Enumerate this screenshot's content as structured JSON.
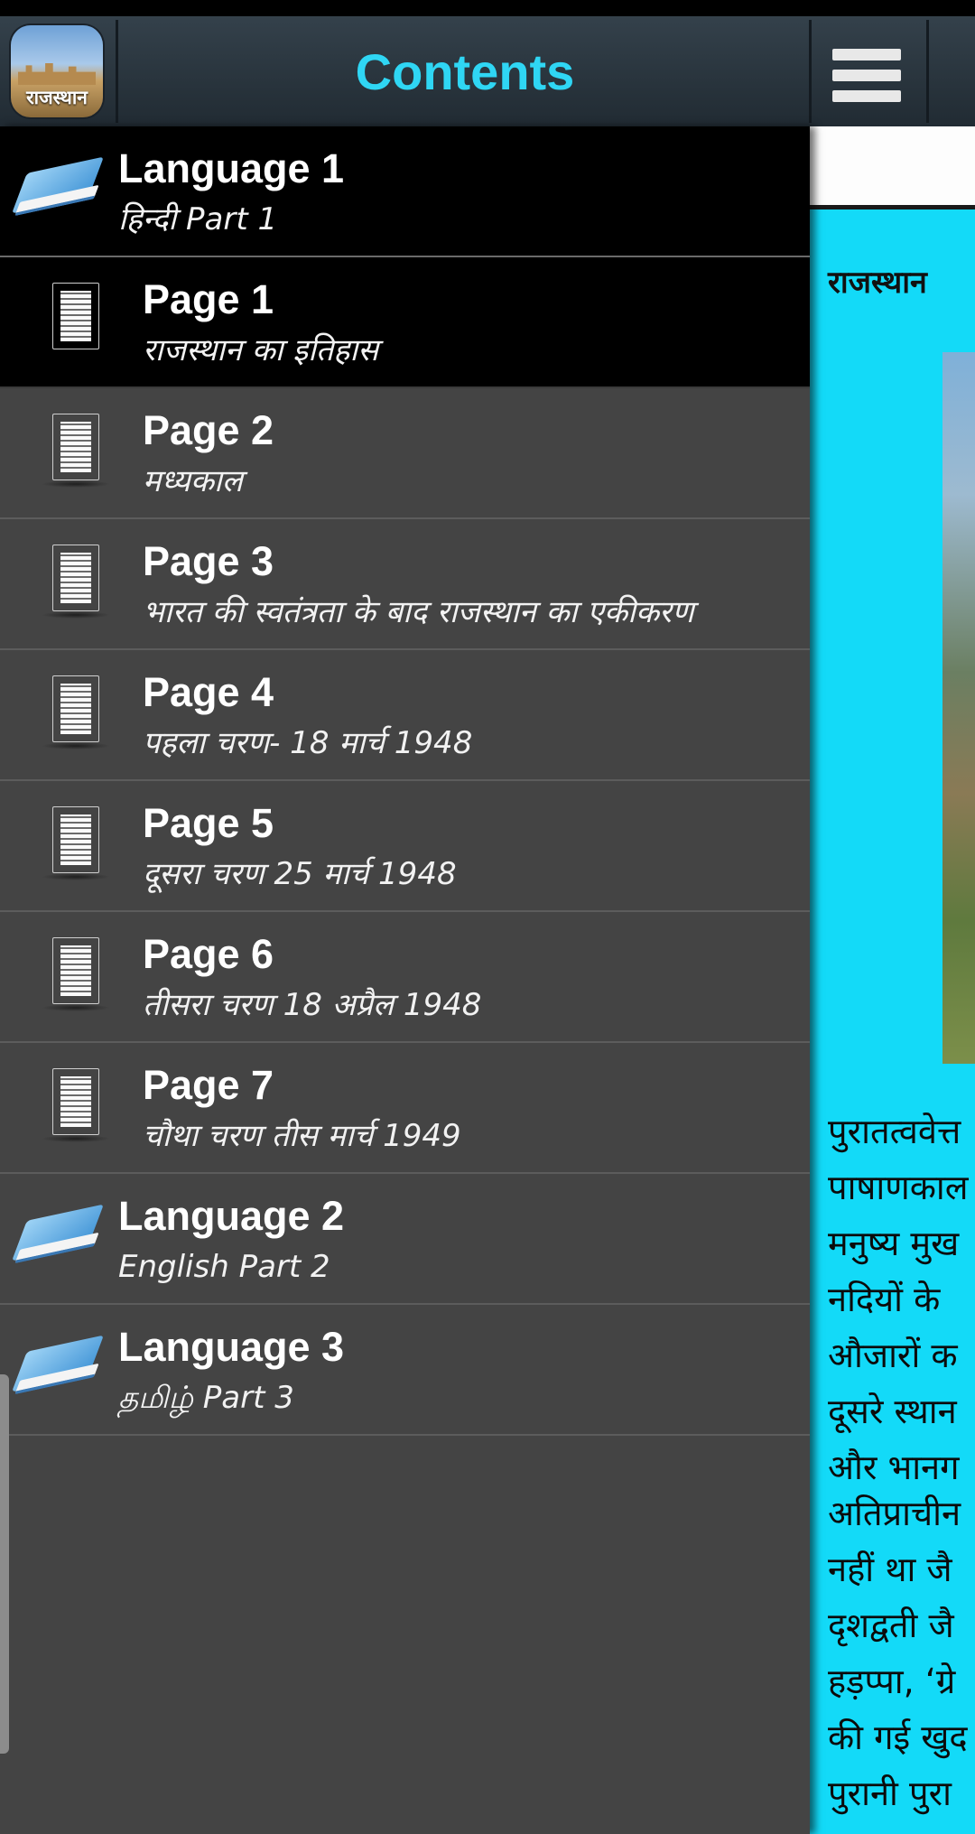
{
  "app": {
    "logo_text": "राजस्थान",
    "header_title": "Contents"
  },
  "drawer": {
    "items": [
      {
        "type": "book",
        "title": "Language 1",
        "subtitle": "हिन्दी Part 1"
      },
      {
        "type": "page",
        "title": "Page 1",
        "subtitle": "राजस्थान का इतिहास",
        "selected": true
      },
      {
        "type": "page",
        "title": "Page 2",
        "subtitle": "मध्यकाल"
      },
      {
        "type": "page",
        "title": "Page 3",
        "subtitle": "भारत की स्वतंत्रता के बाद राजस्थान का एकीकरण"
      },
      {
        "type": "page",
        "title": "Page 4",
        "subtitle": "पहला चरण- 18 मार्च 1948"
      },
      {
        "type": "page",
        "title": "Page 5",
        "subtitle": "दूसरा चरण 25 मार्च 1948"
      },
      {
        "type": "page",
        "title": "Page 6",
        "subtitle": "तीसरा चरण 18 अप्रैल 1948"
      },
      {
        "type": "page",
        "title": "Page 7",
        "subtitle": "चौथा चरण तीस मार्च 1949"
      },
      {
        "type": "book",
        "title": "Language 2",
        "subtitle": "English Part 2"
      },
      {
        "type": "book",
        "title": "Language 3",
        "subtitle": "தமிழ் Part 3"
      }
    ]
  },
  "content": {
    "heading": "राजस्थान",
    "paragraph1": [
      "पुरातत्ववेत्त",
      "पाषाणकाल",
      "मनुष्य मुख",
      "नदियों के",
      "औजारों क",
      "दूसरे स्थान",
      "और भानग"
    ],
    "paragraph2": [
      "अतिप्राचीन",
      "नहीं था जै",
      "दृशद्वती जै",
      "हड़प्पा, ‘ग्रे",
      "की गई खुद",
      "पुरानी पुरा"
    ]
  },
  "colors": {
    "accent": "#2fd6f4",
    "content_bg": "#13daf8",
    "drawer_bg": "#444444",
    "selected_bg": "#000000"
  }
}
